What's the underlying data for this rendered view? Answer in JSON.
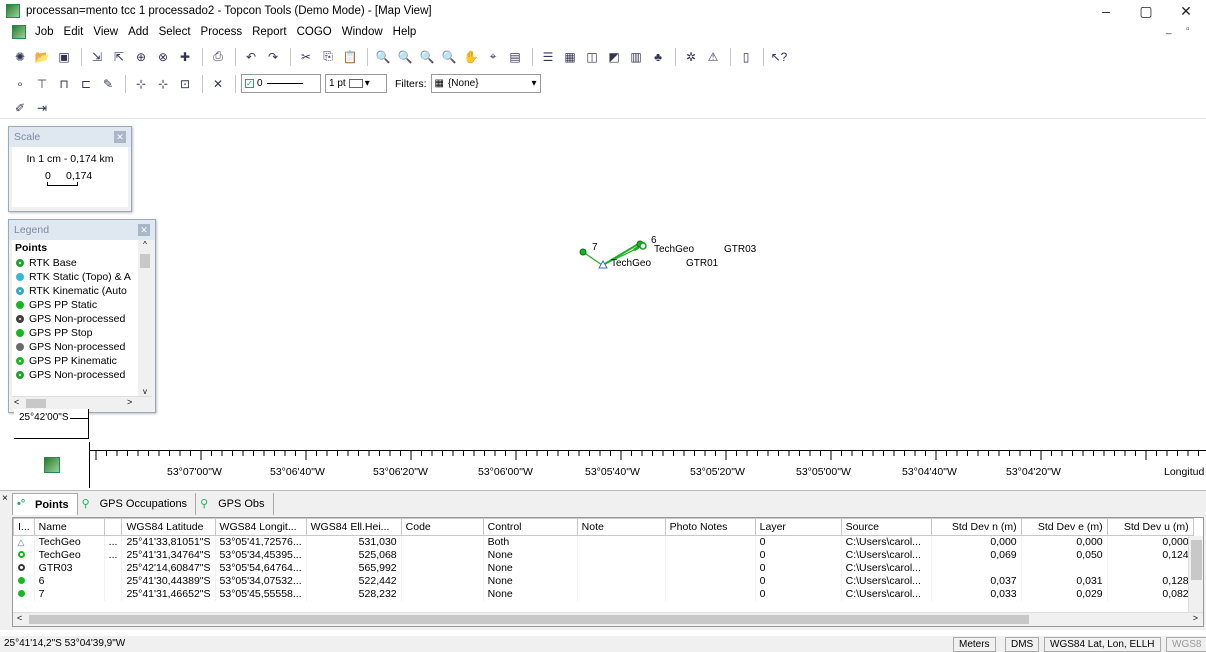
{
  "window": {
    "title": "processan=mento tcc 1 processado2 - Topcon Tools (Demo Mode) - [Map View]",
    "minimize": "–",
    "restore": "▢",
    "close": "✕",
    "mdi_minimize": "_",
    "mdi_restore": "▫"
  },
  "menu": [
    "Job",
    "Edit",
    "View",
    "Add",
    "Select",
    "Process",
    "Report",
    "COGO",
    "Window",
    "Help"
  ],
  "toolbar": {
    "row1_icons": [
      "new-job-icon",
      "open-job-icon",
      "save-icon",
      "import-icon",
      "export-icon",
      "import-gps-icon",
      "export-cad-icon",
      "add-icon",
      "print-icon",
      "undo-icon",
      "redo-icon",
      "cut-icon",
      "copy-icon",
      "paste-icon",
      "zoom-icon",
      "zoom-in-icon",
      "zoom-out-icon",
      "zoom-window-icon",
      "pan-icon",
      "locate-icon",
      "view-icon",
      "tabular-view-icon",
      "map-view-icon",
      "occupation-view-icon",
      "cad-view-icon",
      "list-view-icon",
      "tree-icon",
      "process-icon",
      "adjust-icon",
      "report-icon",
      "help-pointer-icon"
    ],
    "line_value": "0",
    "line_width": "1 pt",
    "filters_label": "Filters:",
    "filters_value": "{None}"
  },
  "scale_panel": {
    "title": "Scale",
    "text": "In 1 cm - 0,174 km",
    "bar_start": "0",
    "bar_end": "0,174"
  },
  "legend": {
    "title": "Legend",
    "section": "Points",
    "items": [
      {
        "label": "RTK Base",
        "color": "#1e9c2e",
        "style": "ring"
      },
      {
        "label": "RTK Static (Topo) & A",
        "color": "#35b8d8",
        "style": "fill"
      },
      {
        "label": "RTK Kinematic (Auto",
        "color": "#35a6c4",
        "style": "ring"
      },
      {
        "label": "GPS PP Static",
        "color": "#13b91f",
        "style": "fill"
      },
      {
        "label": "GPS Non-processed",
        "color": "#3a3a3a",
        "style": "ring"
      },
      {
        "label": "GPS PP Stop",
        "color": "#13b91f",
        "style": "fill"
      },
      {
        "label": "GPS Non-processed",
        "color": "#6a6a6a",
        "style": "fill"
      },
      {
        "label": "GPS PP Kinematic",
        "color": "#13b91f",
        "style": "ring"
      },
      {
        "label": "GPS Non-processed",
        "color": "#1e9c2e",
        "style": "ring"
      }
    ]
  },
  "map": {
    "lat_label": "25°42'00\"S",
    "point_labels": [
      "7",
      "6",
      "TechGeo",
      "GTR03",
      "TechGeo",
      "GTR01"
    ],
    "longitude_ticks": [
      "53°07'00\"W",
      "53°06'40\"W",
      "53°06'20\"W",
      "53°06'00\"W",
      "53°05'40\"W",
      "53°05'20\"W",
      "53°05'00\"W",
      "53°04'40\"W",
      "53°04'20\"W"
    ],
    "axis_label": "Longitud"
  },
  "bottom_tabs": [
    "Points",
    "GPS Occupations",
    "GPS Obs"
  ],
  "grid": {
    "columns": [
      "I...",
      "Name",
      "",
      "WGS84 Latitude",
      "WGS84 Longit...",
      "WGS84 Ell.Hei...",
      "Code",
      "Control",
      "Note",
      "Photo Notes",
      "Layer",
      "Source",
      "Std Dev n (m)",
      "Std Dev e (m)",
      "Std Dev u (m)"
    ],
    "rows": [
      {
        "icon": "triangle",
        "name": "TechGeo",
        "more": "...",
        "lat": "25°41'33,81051\"S",
        "lon": "53°05'41,72576...",
        "height": "531,030",
        "code": "",
        "control": "Both",
        "note": "",
        "photo": "",
        "layer": "0",
        "source": "C:\\Users\\carol...",
        "sn": "0,000",
        "se": "0,000",
        "su": "0,000"
      },
      {
        "icon": "green-ring",
        "name": "TechGeo",
        "more": "...",
        "lat": "25°41'31,34764\"S",
        "lon": "53°05'34,45395...",
        "height": "525,068",
        "code": "",
        "control": "None",
        "note": "",
        "photo": "",
        "layer": "0",
        "source": "C:\\Users\\carol...",
        "sn": "0,069",
        "se": "0,050",
        "su": "0,124"
      },
      {
        "icon": "dark-ring",
        "name": "GTR03",
        "more": "",
        "lat": "25°42'14,60847\"S",
        "lon": "53°05'54,64764...",
        "height": "565,992",
        "code": "",
        "control": "None",
        "note": "",
        "photo": "",
        "layer": "0",
        "source": "C:\\Users\\carol...",
        "sn": "",
        "se": "",
        "su": ""
      },
      {
        "icon": "green-fill",
        "name": "6",
        "more": "",
        "lat": "25°41'30,44389\"S",
        "lon": "53°05'34,07532...",
        "height": "522,442",
        "code": "",
        "control": "None",
        "note": "",
        "photo": "",
        "layer": "0",
        "source": "C:\\Users\\carol...",
        "sn": "0,037",
        "se": "0,031",
        "su": "0,128"
      },
      {
        "icon": "green-fill",
        "name": "7",
        "more": "",
        "lat": "25°41'31,46652\"S",
        "lon": "53°05'45,55558...",
        "height": "528,232",
        "code": "",
        "control": "None",
        "note": "",
        "photo": "",
        "layer": "0",
        "source": "C:\\Users\\carol...",
        "sn": "0,033",
        "se": "0,029",
        "su": "0,082"
      }
    ]
  },
  "status": {
    "coords": "25°41'14,2\"S 53°04'39,9\"W",
    "units": "Meters",
    "angle": "DMS",
    "system": "WGS84 Lat, Lon, ELLH",
    "extra": "WGS8"
  }
}
